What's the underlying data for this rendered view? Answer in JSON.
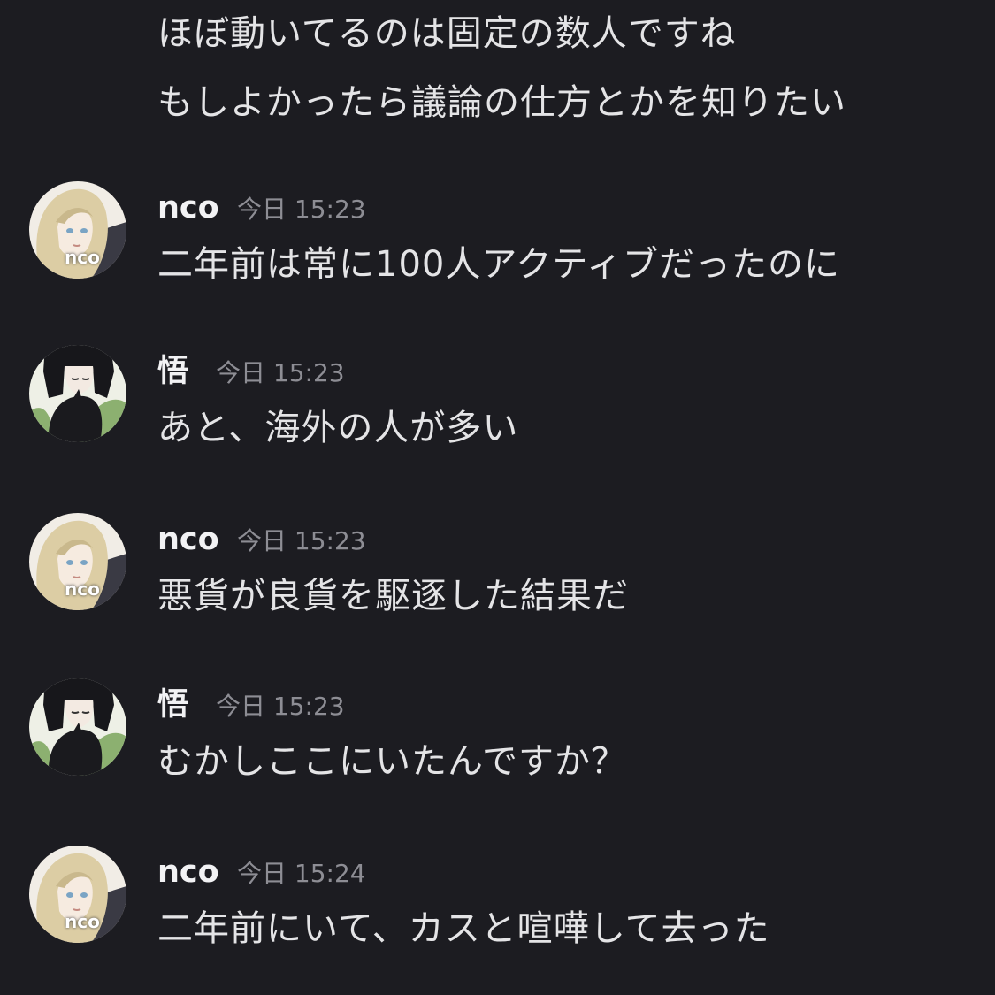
{
  "continuation": [
    "ほぼ動いてるのは固定の数人ですね",
    "もしよかったら議論の仕方とかを知りたい"
  ],
  "messages": [
    {
      "user": "nco",
      "time": "今日 15:23",
      "text": "二年前は常に100人アクティブだったのに",
      "avatar_label": "nco"
    },
    {
      "user": "悟",
      "time": "今日 15:23",
      "text": "あと、海外の人が多い"
    },
    {
      "user": "nco",
      "time": "今日 15:23",
      "text": "悪貨が良貨を駆逐した結果だ",
      "avatar_label": "nco"
    },
    {
      "user": "悟",
      "time": "今日 15:23",
      "text": "むかしここにいたんですか？"
    },
    {
      "user": "nco",
      "time": "今日 15:24",
      "text": "二年前にいて、カスと喧嘩して去った",
      "avatar_label": "nco"
    }
  ],
  "colors": {
    "background": "#1c1c21",
    "text": "#e4e4e6",
    "username": "#f2f2f4",
    "timestamp": "#8d8d94"
  }
}
